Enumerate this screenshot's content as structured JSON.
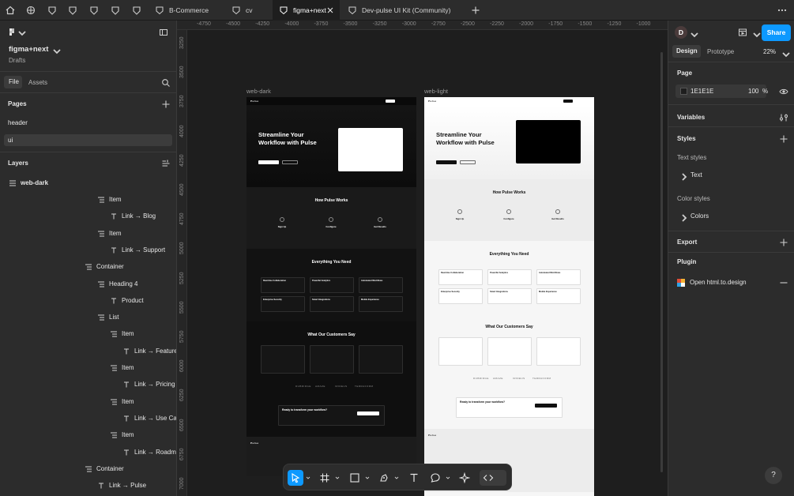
{
  "tabs": [
    {
      "label": "B-Commerce",
      "active": false
    },
    {
      "label": "cv",
      "active": false
    },
    {
      "label": "figma+next",
      "active": true
    },
    {
      "label": "Dev-pulse UI Kit (Community)",
      "active": false
    }
  ],
  "left_panel": {
    "file_name": "figma+next",
    "location": "Drafts",
    "tab_file": "File",
    "tab_assets": "Assets",
    "pages_title": "Pages",
    "pages": [
      "header",
      "ui"
    ],
    "layers_title": "Layers",
    "root_layer": "web-dark",
    "layers": [
      {
        "label": "Item",
        "type": "list"
      },
      {
        "label": "Link → Blog",
        "type": "text"
      },
      {
        "label": "Item",
        "type": "list"
      },
      {
        "label": "Link → Support",
        "type": "text"
      },
      {
        "label": "Container",
        "type": "list"
      },
      {
        "label": "Heading 4",
        "type": "list"
      },
      {
        "label": "Product",
        "type": "text"
      },
      {
        "label": "List",
        "type": "list"
      },
      {
        "label": "Item",
        "type": "list"
      },
      {
        "label": "Link → Features",
        "type": "text"
      },
      {
        "label": "Item",
        "type": "list"
      },
      {
        "label": "Link → Pricing",
        "type": "text"
      },
      {
        "label": "Item",
        "type": "list"
      },
      {
        "label": "Link → Use Cas",
        "type": "text"
      },
      {
        "label": "Item",
        "type": "list"
      },
      {
        "label": "Link → Roadma",
        "type": "text"
      },
      {
        "label": "Container",
        "type": "list"
      },
      {
        "label": "Link → Pulse",
        "type": "text"
      }
    ]
  },
  "canvas": {
    "ruler_top": [
      "-4750",
      "-4500",
      "-4250",
      "-4000",
      "-3750",
      "-3500",
      "-3250",
      "-3000",
      "-2750",
      "-2500",
      "-2250",
      "-2000",
      "-1750",
      "-1500",
      "-1250",
      "-1000"
    ],
    "ruler_left": [
      "3250",
      "3500",
      "3750",
      "4000",
      "4250",
      "4500",
      "4750",
      "5000",
      "5250",
      "5500",
      "5750",
      "6000",
      "6250",
      "6500",
      "6750",
      "7000"
    ],
    "frames": [
      {
        "label": "web-dark",
        "theme": "dark",
        "brand": "Pulse",
        "hero_title_1": "Streamline Your",
        "hero_title_2": "Workflow with Pulse",
        "how_title": "How Pulse Works",
        "steps": [
          "Sign Up",
          "Configure",
          "Get Results"
        ],
        "everything_title": "Everything You Need",
        "features": [
          "Real-time Collaboration",
          "Powerful Analytics",
          "Automated Workflows",
          "Enterprise Security",
          "Smart Integrations",
          "Mobile Experience"
        ],
        "customers_title": "What Our Customers Say",
        "cta_title": "Ready to transform your workflow?",
        "logos": [
          "DUBRIDGE",
          "AMAZE",
          "IRIDEUS",
          "TERRAFORM"
        ]
      },
      {
        "label": "web-light",
        "theme": "light",
        "brand": "Pulse",
        "hero_title_1": "Streamline Your",
        "hero_title_2": "Workflow with Pulse",
        "how_title": "How Pulse Works",
        "steps": [
          "Sign Up",
          "Configure",
          "Get Results"
        ],
        "everything_title": "Everything You Need",
        "features": [
          "Real-time Collaboration",
          "Powerful Analytics",
          "Automated Workflows",
          "Enterprise Security",
          "Smart Integrations",
          "Mobile Experience"
        ],
        "customers_title": "What Our Customers Say",
        "cta_title": "Ready to transform your workflow?",
        "logos": [
          "DUBRIDGE",
          "AMAZE",
          "IRIDEUS",
          "TERRAFORM"
        ]
      }
    ]
  },
  "right_panel": {
    "avatar_initial": "D",
    "share_label": "Share",
    "tab_design": "Design",
    "tab_prototype": "Prototype",
    "zoom": "22%",
    "page_title": "Page",
    "page_color": "1E1E1E",
    "page_opacity": "100",
    "percent_sign": "%",
    "variables_title": "Variables",
    "styles_title": "Styles",
    "text_styles_title": "Text styles",
    "text_style_item": "Text",
    "color_styles_title": "Color styles",
    "color_style_item": "Colors",
    "export_title": "Export",
    "plugin_title": "Plugin",
    "plugin_item": "Open html.to.design",
    "help_label": "?",
    "accent_color": "#0d99ff"
  }
}
